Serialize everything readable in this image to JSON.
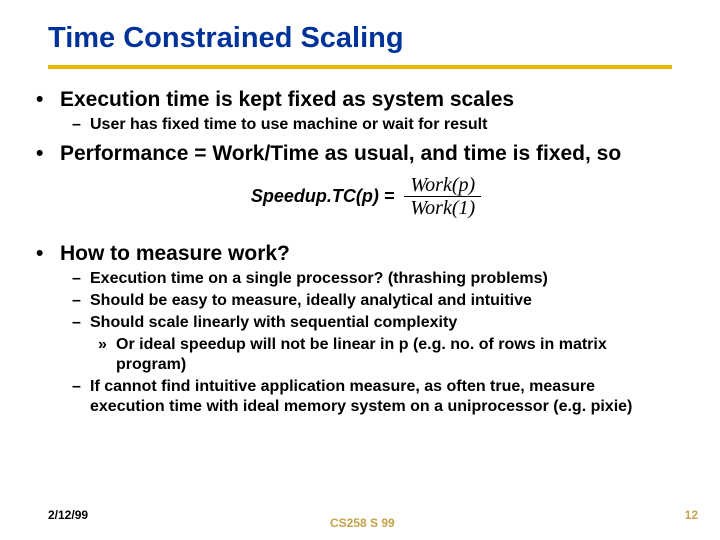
{
  "title": "Time Constrained Scaling",
  "bullets": {
    "exec": "Execution time is kept fixed as system scales",
    "exec_sub": "User has fixed time to use machine or wait for result",
    "perf": "Performance = Work/Time as usual, and time is fixed, so",
    "formula_lhs": "Speedup.TC(p)  =",
    "formula_num": "Work(p)",
    "formula_den": "Work(1)",
    "how": "How to measure work?",
    "how_subs": [
      "Execution time on a single processor?  (thrashing problems)",
      "Should be easy to measure, ideally analytical and intuitive",
      "Should scale linearly with sequential complexity"
    ],
    "how_sub_sub": "Or ideal speedup will not be linear in p (e.g. no. of rows in matrix program)",
    "cannot": "If cannot find intuitive application measure, as often true, measure execution time with ideal memory system on a uniprocessor (e.g. pixie)"
  },
  "footer": {
    "date": "2/12/99",
    "course": "CS258 S 99",
    "page": "12"
  }
}
